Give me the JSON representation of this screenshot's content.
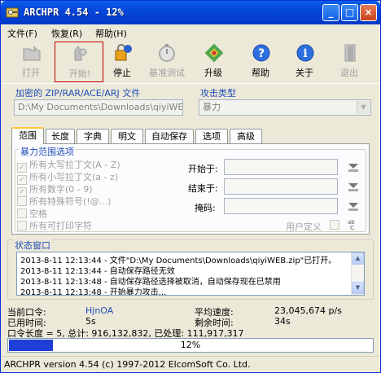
{
  "window": {
    "title": "ARCHPR 4.54 - 12%",
    "buttons": {
      "minimize": "_",
      "maximize": "□",
      "close": "×"
    }
  },
  "menu": [
    {
      "label": "文件(F)"
    },
    {
      "label": "恢复(R)"
    },
    {
      "label": "帮助(H)"
    }
  ],
  "toolbar": [
    {
      "label": "打开",
      "icon": "open-folder-icon",
      "enabled": false
    },
    {
      "label": "开始!",
      "icon": "start-icon",
      "enabled": false
    },
    {
      "label": "停止",
      "icon": "stop-icon",
      "enabled": true
    },
    {
      "label": "基准测试",
      "icon": "stopwatch-icon",
      "enabled": false
    },
    {
      "label": "升级",
      "icon": "upgrade-icon",
      "enabled": true
    },
    {
      "label": "帮助",
      "icon": "help-icon",
      "enabled": true
    },
    {
      "label": "关于",
      "icon": "info-icon",
      "enabled": true
    },
    {
      "label": "退出",
      "icon": "exit-door-icon",
      "enabled": false
    }
  ],
  "file_group": {
    "title": "加密的 ZIP/RAR/ACE/ARJ 文件",
    "path": "D:\\My Documents\\Downloads\\qiyiWEB.zip"
  },
  "attack_group": {
    "title": "攻击类型",
    "value": "暴力"
  },
  "tabs": [
    "范围",
    "长度",
    "字典",
    "明文",
    "自动保存",
    "选项",
    "高级"
  ],
  "active_tab": 0,
  "range_panel": {
    "group_title": "暴力范围选项",
    "options": [
      {
        "label": "所有大写拉丁文(A - Z)",
        "checked": true
      },
      {
        "label": "所有小写拉丁文(a - z)",
        "checked": true
      },
      {
        "label": "所有数字(0 - 9)",
        "checked": true
      },
      {
        "label": "所有特殊符号(!@...)",
        "checked": false
      },
      {
        "label": "空格",
        "checked": false
      },
      {
        "label": "所有可打印字符",
        "checked": false
      }
    ],
    "start_label": "开始于:",
    "end_label": "结束于:",
    "mask_label": "掩码:",
    "user_defined_label": "用户定义"
  },
  "status_window": {
    "title": "状态窗口",
    "lines": [
      "2013-8-11 12:13:44 - 文件\"D:\\My Documents\\Downloads\\qiyiWEB.zip\"已打开。",
      "2013-8-11 12:13:44 - 自动保存路径无效",
      "2013-8-11 12:13:48 - 自动保存路径选择被取消，自动保存现在已禁用",
      "2013-8-11 12:13:48 - 开始暴力攻击..."
    ]
  },
  "stats": {
    "current_password_label": "当前口令:",
    "current_password": "HjnOA",
    "avg_speed_label": "平均速度:",
    "avg_speed": "23,045,674 p/s",
    "elapsed_label": "已用时间:",
    "elapsed": "5s",
    "remaining_label": "剩余时间:",
    "remaining": "34s",
    "summary": "口令长度 = 5, 总计: 916,132,832, 已处理: 111,917,317"
  },
  "progress": {
    "percent": 12,
    "text": "12%"
  },
  "status_bar": "ARCHPR version 4.54 (c) 1997-2012 ElcomSoft Co. Ltd."
}
